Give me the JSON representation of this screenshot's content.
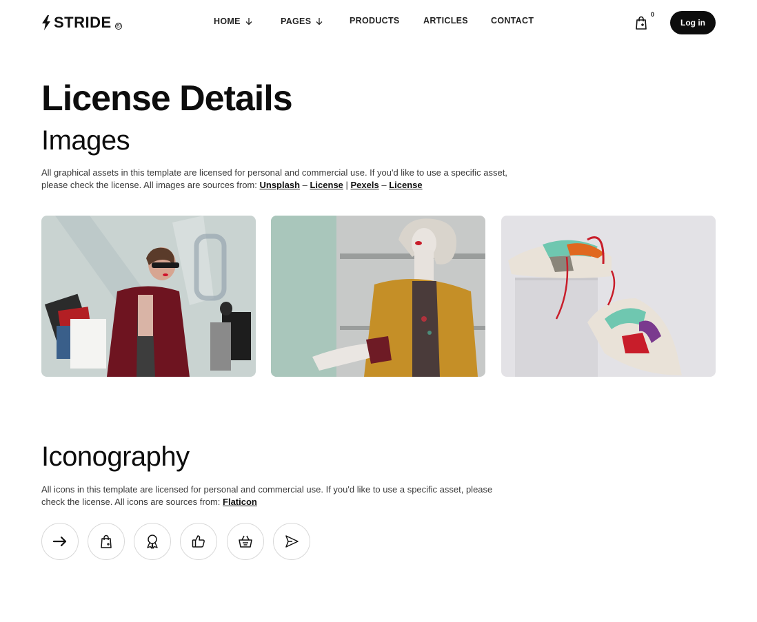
{
  "brand": {
    "name": "STRIDE",
    "registered_mark": "®"
  },
  "nav": {
    "items": [
      {
        "label": "HOME",
        "has_dropdown": true
      },
      {
        "label": "PAGES",
        "has_dropdown": true
      },
      {
        "label": "PRODUCTS",
        "has_dropdown": false
      },
      {
        "label": "ARTICLES",
        "has_dropdown": false
      },
      {
        "label": "CONTACT",
        "has_dropdown": false
      }
    ]
  },
  "cart": {
    "count": "0",
    "icon": "shopping-bag-icon"
  },
  "auth": {
    "login_label": "Log in"
  },
  "page": {
    "title": "License Details"
  },
  "images_section": {
    "title": "Images",
    "text": "All graphical assets in this template are licensed for personal and commercial use. If you'd like to use a specific asset, please check the license. All images are sources from:",
    "links": [
      "Unsplash",
      "License",
      "Pexels",
      "License"
    ],
    "separators": [
      " – ",
      " | ",
      " – "
    ],
    "images": [
      {
        "name": "woman-with-shopping-bags-image"
      },
      {
        "name": "mannequin-in-yellow-cardigan-image"
      },
      {
        "name": "sneakers-on-pedestal-image"
      }
    ]
  },
  "iconography_section": {
    "title": "Iconography",
    "text": "All icons in this template are licensed for personal and commercial use. If you'd like to use a specific asset, please check the license. All icons are sources from:",
    "link": "Flaticon",
    "icons": [
      "arrow-right-icon",
      "shopping-bag-icon",
      "award-badge-icon",
      "thumbs-up-icon",
      "shopping-basket-icon",
      "send-icon"
    ]
  },
  "colors": {
    "text": "#0d0d0d",
    "button_bg": "#0d0d0d",
    "button_text": "#ffffff",
    "muted_text": "#3a3a3a",
    "border": "#d8d8d8"
  }
}
